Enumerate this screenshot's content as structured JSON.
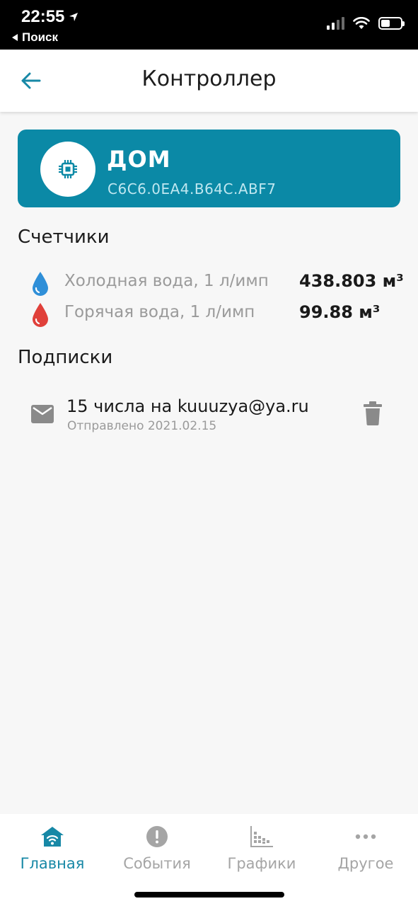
{
  "status_bar": {
    "time": "22:55",
    "back_label": "Поиск"
  },
  "header": {
    "title": "Контроллер"
  },
  "controller": {
    "name": "ДОМ",
    "id": "C6C6.0EA4.B64C.ABF7",
    "card_color": "#0b89a6"
  },
  "meters": {
    "section_title": "Счетчики",
    "items": [
      {
        "label": "Холодная вода, 1 л/имп",
        "value": "438.803 м³",
        "icon": "cold-water-drop-icon",
        "color": "#2f8fd8"
      },
      {
        "label": "Горячая вода, 1 л/имп",
        "value": "99.88 м³",
        "icon": "hot-water-drop-icon",
        "color": "#e0403a"
      }
    ]
  },
  "subscriptions": {
    "section_title": "Подписки",
    "items": [
      {
        "title": "15 числа на kuuuzya@ya.ru",
        "status": "Отправлено 2021.02.15",
        "icon": "mail-icon",
        "action_icon": "trash-icon"
      }
    ]
  },
  "bottom_nav": {
    "active_color": "#1788a6",
    "items": [
      {
        "label": "Главная",
        "icon": "home-wifi-icon",
        "active": true
      },
      {
        "label": "События",
        "icon": "alert-icon",
        "active": false
      },
      {
        "label": "Графики",
        "icon": "chart-icon",
        "active": false
      },
      {
        "label": "Другое",
        "icon": "more-icon",
        "active": false
      }
    ]
  }
}
